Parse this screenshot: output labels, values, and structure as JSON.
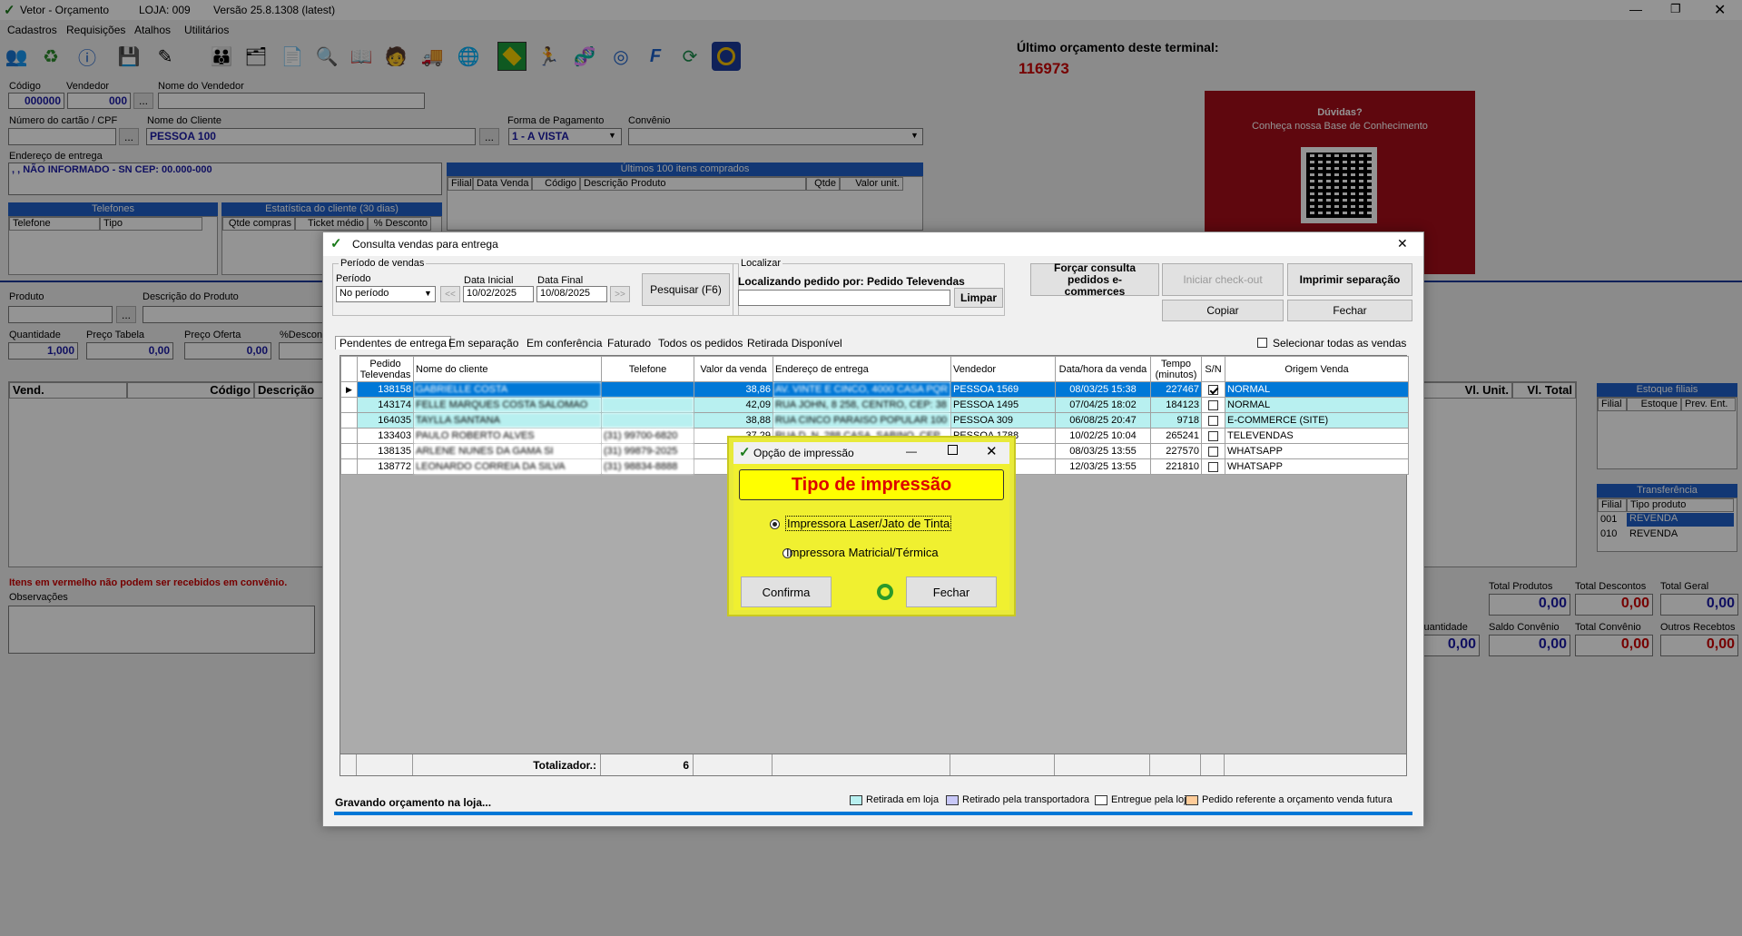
{
  "app": {
    "title": "Vetor - Orçamento",
    "loja": "LOJA: 009",
    "versao": "Versão 25.8.1308 (latest)",
    "menu": [
      "Cadastros",
      "Requisições",
      "Atalhos",
      "Utilitários"
    ]
  },
  "ultimo": {
    "label": "Último orçamento deste terminal:",
    "value": "116973"
  },
  "promo": {
    "title": "Dúvidas?",
    "subtitle": "Conheça nossa Base de Conhecimento"
  },
  "form": {
    "codigo_label": "Código",
    "codigo": "000000",
    "vendedor_label": "Vendedor",
    "vendedor": "000",
    "nome_vendedor_label": "Nome do Vendedor",
    "cartao_label": "Número do cartão / CPF",
    "nome_cliente_label": "Nome do Cliente",
    "nome_cliente": "PESSOA 100",
    "forma_pag_label": "Forma de Pagamento",
    "forma_pag": "1 - A VISTA",
    "convenio_label": "Convênio",
    "endereco_label": "Endereço de entrega",
    "endereco": ", , NÃO INFORMADO - SN CEP: 00.000-000",
    "ultimos_label": "Últimos 100 itens comprados",
    "ultimos_cols": [
      "Filial",
      "Data Venda",
      "Código",
      "Descrição Produto",
      "Qtde",
      "Valor unit."
    ],
    "telefones_label": "Telefones",
    "tel_cols": [
      "Telefone",
      "Tipo"
    ],
    "estat_label": "Estatística do cliente (30 dias)",
    "estat_cols": [
      "Qtde compras",
      "Ticket médio",
      "% Desconto"
    ],
    "produto_label": "Produto",
    "descricao_label": "Descrição do Produto",
    "quantidade_label": "Quantidade",
    "quantidade": "1,000",
    "preco_tabela_label": "Preço Tabela",
    "preco_tabela": "0,00",
    "preco_oferta_label": "Preço Oferta",
    "preco_oferta": "0,00",
    "desconto_label": "%Desconto",
    "grid_cols": [
      "Vend.",
      "Código",
      "Descrição"
    ],
    "grid_right_cols": [
      "Vl. Unit.",
      "Vl. Total"
    ],
    "aviso": "Itens em vermelho não podem ser recebidos em convênio.",
    "observacoes_label": "Observações",
    "estoque_label": "Estoque filiais",
    "estoque_cols": [
      "Filial",
      "Estoque",
      "Prev. Ent."
    ],
    "transf_label": "Transferência",
    "transf_cols": [
      "Filial",
      "Tipo produto"
    ],
    "transf_rows": [
      [
        "001",
        "REVENDA"
      ],
      [
        "010",
        "REVENDA"
      ]
    ],
    "totais": [
      {
        "label": "Total Produtos",
        "value": "0,00",
        "color": "#1a1aa6"
      },
      {
        "label": "Total Descontos",
        "value": "0,00",
        "color": "#cc0000"
      },
      {
        "label": "Total Geral",
        "value": "0,00",
        "color": "#1a1aa6"
      }
    ],
    "totais2": [
      {
        "label": "Quantidade",
        "value": "0,00",
        "color": "#1a1aa6"
      },
      {
        "label": "Saldo Convênio",
        "value": "0,00",
        "color": "#1a1aa6"
      },
      {
        "label": "Total Convênio",
        "value": "0,00",
        "color": "#cc0000"
      },
      {
        "label": "Outros Recebtos",
        "value": "0,00",
        "color": "#cc0000"
      }
    ]
  },
  "consulta": {
    "title": "Consulta vendas para entrega",
    "periodo_group": "Período de vendas",
    "periodo_label": "Período",
    "periodo": "No período",
    "data_inicial_label": "Data Inicial",
    "data_inicial": "10/02/2025",
    "data_final_label": "Data Final",
    "data_final": "10/08/2025",
    "prev": "<<",
    "next": ">>",
    "pesquisar": "Pesquisar (F6)",
    "localizar_group": "Localizar",
    "localizando": "Localizando pedido por: Pedido Televendas",
    "limpar": "Limpar",
    "forcar": "Forçar consulta pedidos e-commerces",
    "iniciar": "Iniciar check-out",
    "imprimir": "Imprimir separação",
    "copiar": "Copiar",
    "fechar": "Fechar",
    "tabs": [
      "Pendentes de entrega",
      "Em separação",
      "Em conferência",
      "Faturado",
      "Todos os pedidos",
      "Retirada Disponível"
    ],
    "selecionar_todas": "Selecionar todas as vendas",
    "columns": [
      "Pedido Televendas",
      "Nome do cliente",
      "Telefone",
      "Valor da venda",
      "Endereço de entrega",
      "Vendedor",
      "Data/hora da venda",
      "Tempo (minutos)",
      "S/N",
      "Origem Venda"
    ],
    "rows": [
      {
        "pedido": "138158",
        "nome": "GABRIELLE COSTA",
        "telefone": "",
        "valor": "38,86",
        "endereco": "AV. VINTE E CINCO, 4000 CASA PQR",
        "vendedor": "PESSOA 1569",
        "data": "08/03/25 15:38",
        "tempo": "227467",
        "sn": true,
        "origem": "NORMAL",
        "selected": true,
        "color": "#0078d7"
      },
      {
        "pedido": "143174",
        "nome": "FELLE MARQUES COSTA SALOMAO",
        "telefone": "",
        "valor": "42,09",
        "endereco": "RUA JOHN, 8 258, CENTRO, CEP: 38",
        "vendedor": "PESSOA 1495",
        "data": "07/04/25 18:02",
        "tempo": "184123",
        "sn": false,
        "origem": "NORMAL",
        "selected": false,
        "color": "#b8f0f0"
      },
      {
        "pedido": "164035",
        "nome": "TAYLLA SANTANA",
        "telefone": "",
        "valor": "38,88",
        "endereco": "RUA CINCO PARAISO POPULAR 100",
        "vendedor": "PESSOA 309",
        "data": "06/08/25 20:47",
        "tempo": "9718",
        "sn": false,
        "origem": "E-COMMERCE (SITE)",
        "selected": false,
        "color": "#b8f0f0"
      },
      {
        "pedido": "133403",
        "nome": "PAULO ROBERTO ALVES",
        "telefone": "(31) 99700-6820",
        "valor": "37,29",
        "endereco": "RUA D, N, 288 CASA, SABINO, CEP",
        "vendedor": "PESSOA 1788",
        "data": "10/02/25 10:04",
        "tempo": "265241",
        "sn": false,
        "origem": "TELEVENDAS",
        "selected": false,
        "color": "#ffffff"
      },
      {
        "pedido": "138135",
        "nome": "ARLENE NUNES DA GAMA SI",
        "telefone": "(31) 99879-2025",
        "valor": "",
        "endereco": "",
        "vendedor": "",
        "data": "08/03/25 13:55",
        "tempo": "227570",
        "sn": false,
        "origem": "WHATSAPP",
        "selected": false,
        "color": "#ffffff"
      },
      {
        "pedido": "138772",
        "nome": "LEONARDO CORREIA DA SILVA",
        "telefone": "(31) 98834-8888",
        "valor": "",
        "endereco": "",
        "vendedor": "",
        "data": "12/03/25 13:55",
        "tempo": "221810",
        "sn": false,
        "origem": "WHATSAPP",
        "selected": false,
        "color": "#ffffff"
      }
    ],
    "totalizador_label": "Totalizador.:",
    "totalizador": "6",
    "status": "Gravando orçamento na loja...",
    "legend": [
      {
        "label": "Retirada em loja",
        "color": "#b8f0f0"
      },
      {
        "label": "Retirado pela transportadora",
        "color": "#c8c8f8"
      },
      {
        "label": "Entregue pela loja",
        "color": "#ffffff"
      },
      {
        "label": "Pedido referente a orçamento venda futura",
        "color": "#ffcc99"
      }
    ]
  },
  "dialog": {
    "title": "Opção de impressão",
    "heading": "Tipo de impressão",
    "options": [
      "Impressora Laser/Jato de Tinta",
      "Impressora Matricial/Térmica"
    ],
    "confirma": "Confirma",
    "fechar": "Fechar"
  }
}
